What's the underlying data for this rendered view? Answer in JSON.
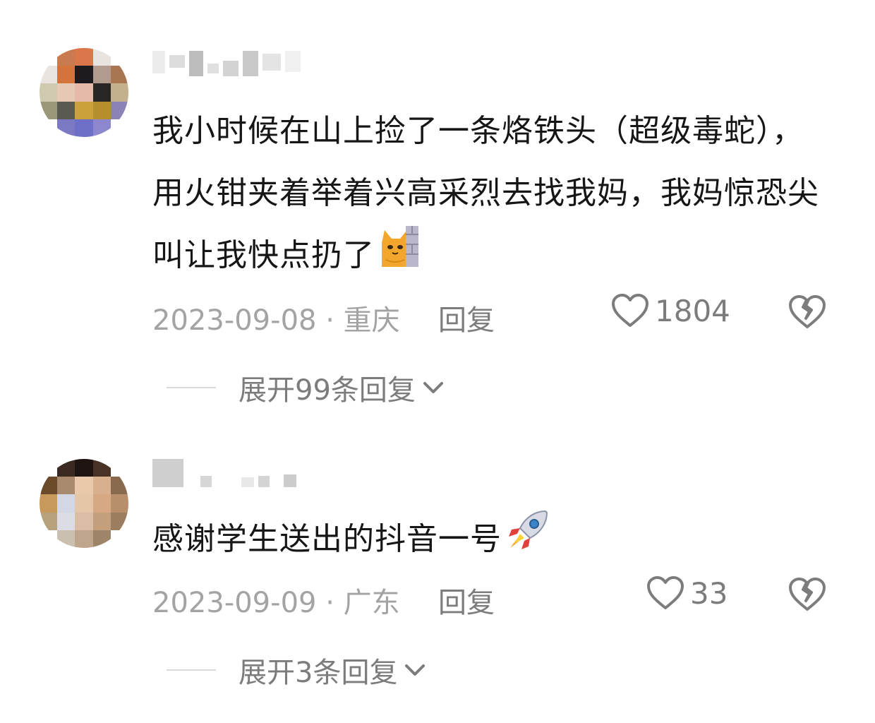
{
  "comments": [
    {
      "username": "",
      "text": "我小时候在山上捡了一条烙铁头（超级毒蛇），用火钳夹着举着兴高采烈去找我妈，我妈惊恐尖叫让我快点扔了",
      "emoji_icon": "cat-behind-wall-emoji",
      "date": "2023-09-08",
      "separator": "·",
      "location": "重庆",
      "reply_label": "回复",
      "like_count": "1804",
      "expand_label": "展开99条回复"
    },
    {
      "username": "",
      "text": "感谢学生送出的抖音一号",
      "emoji_icon": "rocket-emoji",
      "date": "2023-09-09",
      "separator": "·",
      "location": "广东",
      "reply_label": "回复",
      "like_count": "33",
      "expand_label": "展开3条回复"
    }
  ],
  "icons": {
    "like": "heart-outline-icon",
    "dislike": "broken-heart-icon",
    "expand": "chevron-down-icon"
  },
  "colors": {
    "text_primary": "#161616",
    "text_secondary": "#a3a3a3",
    "text_action": "#7c7c7c"
  }
}
